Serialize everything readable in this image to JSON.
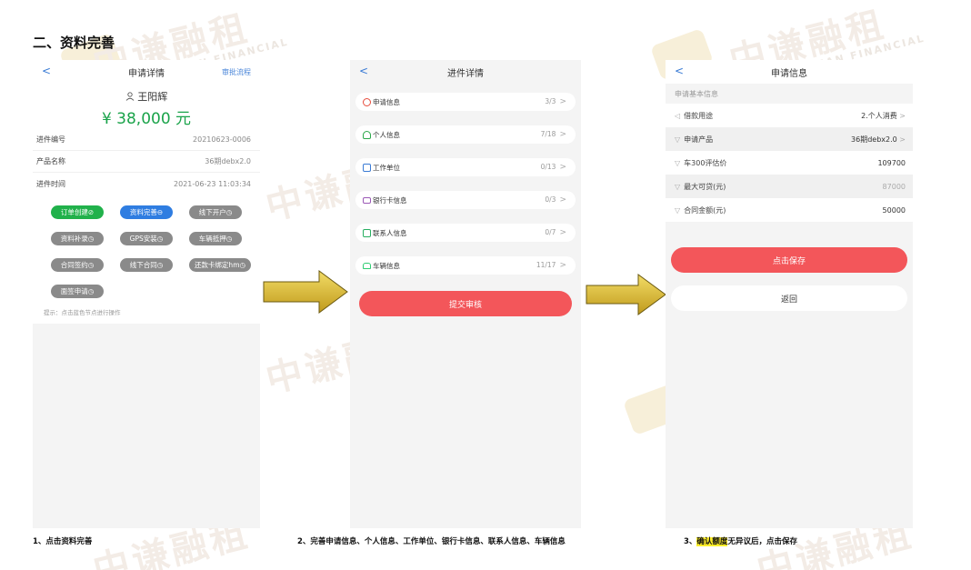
{
  "section_title": "二、资料完善",
  "watermark": {
    "text": "中谦融租",
    "sub": "ZHONGQIAN FINANCIAL"
  },
  "phone1": {
    "nav_back": "<",
    "nav_title": "申请详情",
    "nav_right": "审批流程",
    "user_icon": "person-icon",
    "name": "王阳辉",
    "amount": "¥ 38,000 元",
    "rows": [
      {
        "label": "进件编号",
        "value": "20210623-0006"
      },
      {
        "label": "产品名称",
        "value": "36期debx2.0"
      },
      {
        "label": "进件时间",
        "value": "2021-06-23 11:03:34"
      }
    ],
    "buttons": [
      {
        "label": "订单创建⊘",
        "style": "green"
      },
      {
        "label": "资料完善⊖",
        "style": "blue"
      },
      {
        "label": "线下开户◷",
        "style": "gray"
      },
      {
        "label": "资料补录◷",
        "style": "gray"
      },
      {
        "label": "GPS安装◷",
        "style": "gray"
      },
      {
        "label": "车辆抵押◷",
        "style": "gray"
      },
      {
        "label": "合同签约◷",
        "style": "gray"
      },
      {
        "label": "线下合同◷",
        "style": "gray"
      },
      {
        "label": "还款卡绑定hm◷",
        "style": "gray"
      },
      {
        "label": "面签申请◷",
        "style": "gray"
      }
    ],
    "tip": "提示：点击蓝色节点进行操作"
  },
  "phone2": {
    "nav_back": "<",
    "nav_title": "进件详情",
    "items": [
      {
        "label": "申请信息",
        "count": "3/3",
        "icon": "user-red-icon",
        "color": "#e74c3c"
      },
      {
        "label": "个人信息",
        "count": "7/18",
        "icon": "person-green-icon",
        "color": "#2ca84a"
      },
      {
        "label": "工作单位",
        "count": "0/13",
        "icon": "building-blue-icon",
        "color": "#3a7bd5"
      },
      {
        "label": "银行卡信息",
        "count": "0/3",
        "icon": "card-purple-icon",
        "color": "#9b59b6"
      },
      {
        "label": "联系人信息",
        "count": "0/7",
        "icon": "contacts-green-icon",
        "color": "#27ae60"
      },
      {
        "label": "车辆信息",
        "count": "11/17",
        "icon": "car-green-icon",
        "color": "#2ecc71"
      }
    ],
    "submit_label": "提交审核"
  },
  "phone3": {
    "nav_back": "<",
    "nav_title": "申请信息",
    "subtitle": "申请基本信息",
    "rows": [
      {
        "label": "借款用途",
        "value": "2.个人消费",
        "chev": ">",
        "alt": false,
        "muted": false,
        "icon": "send-icon"
      },
      {
        "label": "申请产品",
        "value": "36期debx2.0",
        "chev": ">",
        "alt": true,
        "muted": false,
        "icon": "shield-icon"
      },
      {
        "label": "车300评估价",
        "value": "109700",
        "chev": "",
        "alt": false,
        "muted": false,
        "icon": "shield-icon"
      },
      {
        "label": "最大可贷(元)",
        "value": "87000",
        "chev": "",
        "alt": true,
        "muted": true,
        "icon": "shield-icon"
      },
      {
        "label": "合同金额(元)",
        "value": "50000",
        "chev": "",
        "alt": false,
        "muted": false,
        "icon": "shield-icon"
      }
    ],
    "save_label": "点击保存",
    "back_label": "返回"
  },
  "captions": {
    "c1": "1、点击资料完善",
    "c2": "2、完善申请信息、个人信息、工作单位、银行卡信息、联系人信息、车辆信息",
    "c3_prefix": "3、",
    "c3_highlight": "确认额度",
    "c3_suffix": "无异议后，点击保存"
  },
  "colors": {
    "primary_red": "#f3565a",
    "green": "#21b14b",
    "blue": "#2f7de1",
    "arrow": "#d8b92c"
  }
}
